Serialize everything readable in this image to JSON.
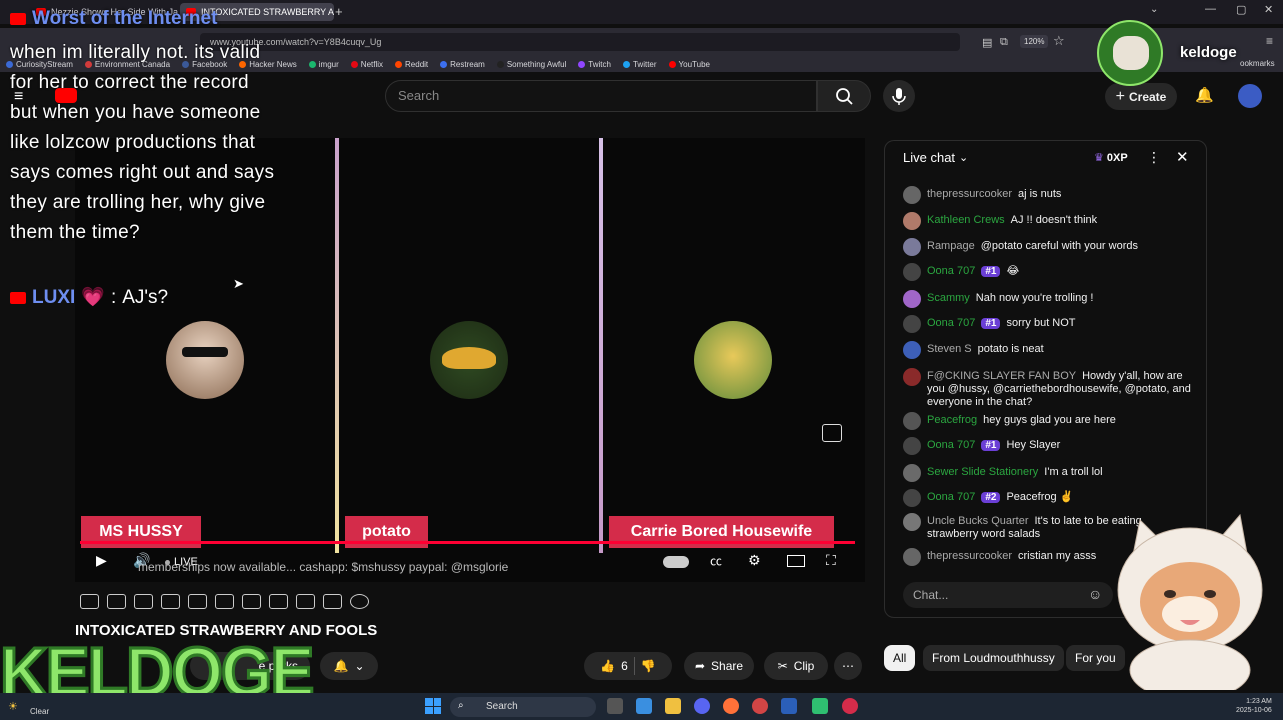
{
  "browser": {
    "tabs": [
      {
        "title": "Nezzie Shows Her Side With Ja"
      },
      {
        "title": "INTOXICATED STRAWBERRY AN"
      }
    ],
    "new_tab_icon": "plus-icon",
    "url": "www.youtube.com/watch?v=Y8B4cuqv_Ug",
    "zoom": "120%",
    "bookmarks": [
      {
        "label": "CuriosityStream",
        "color": "#3b6ad6"
      },
      {
        "label": "Environment Canada",
        "color": "#d13b3b"
      },
      {
        "label": "Facebook",
        "color": "#3b5998"
      },
      {
        "label": "Hacker News",
        "color": "#ff6600"
      },
      {
        "label": "imgur",
        "color": "#1bb76e"
      },
      {
        "label": "Netflix",
        "color": "#e50914"
      },
      {
        "label": "Reddit",
        "color": "#ff4500"
      },
      {
        "label": "Restream",
        "color": "#3c6ff0"
      },
      {
        "label": "Something Awful",
        "color": "#222222"
      },
      {
        "label": "Twitch",
        "color": "#9146ff"
      },
      {
        "label": "Twitter",
        "color": "#1da1f2"
      },
      {
        "label": "YouTube",
        "color": "#ff0000"
      }
    ],
    "bookmarks_more": "ookmarks"
  },
  "youtube": {
    "search_placeholder": "Search",
    "create_label": "Create",
    "video_title": "INTOXICATED STRAWBERRY AND FOOLS",
    "join_label": "e perks",
    "like_count": "6",
    "share_label": "Share",
    "clip_label": "Clip",
    "live_label": "LIVE",
    "ticker": "memberships now available... cashapp: $mshussy paypal: @msglorie",
    "participants": [
      {
        "name": "MS HUSSY",
        "avatar_color": "#c9a48a"
      },
      {
        "name": "potato",
        "avatar_color": "#6b8a3a"
      },
      {
        "name": "Carrie Bored Housewife",
        "avatar_color": "#9fb43a"
      }
    ],
    "chat": {
      "title": "Live chat",
      "xp": "0XP",
      "input_placeholder": "Chat...",
      "messages": [
        {
          "author": "thepressurcooker",
          "text": "aj is nuts",
          "color": "#aaaaaa",
          "badge": "",
          "avatar": "#666666"
        },
        {
          "author": "Kathleen Crews",
          "text": "AJ !! doesn't think",
          "color": "#2ba640",
          "badge": "",
          "avatar": "#b07a6a"
        },
        {
          "author": "Rampage",
          "text": "@potato careful with your words",
          "color": "#aaaaaa",
          "badge": "",
          "avatar": "#7a7a9a"
        },
        {
          "author": "Oona 707",
          "text": "😂",
          "color": "#2ba640",
          "badge": "#1",
          "avatar": "#444444"
        },
        {
          "author": "Scammy",
          "text": "Nah now you're trolling !",
          "color": "#2ba640",
          "badge": "",
          "avatar": "#a066c8"
        },
        {
          "author": "Oona 707",
          "text": "sorry but NOT",
          "color": "#2ba640",
          "badge": "#1",
          "avatar": "#444444"
        },
        {
          "author": "Steven S",
          "text": "potato is neat",
          "color": "#aaaaaa",
          "badge": "",
          "avatar": "#3d5fb8"
        },
        {
          "author": "F@CKING SLAYER FAN BOY",
          "text": "Howdy y'all, how are you @hussy, @carriethebordhousewife, @potato, and everyone in the chat?",
          "color": "#aaaaaa",
          "badge": "",
          "avatar": "#8a2a2a"
        },
        {
          "author": "Peacefrog",
          "text": "hey guys glad you are here",
          "color": "#2ba640",
          "badge": "",
          "avatar": "#555555"
        },
        {
          "author": "Oona 707",
          "text": "Hey Slayer",
          "color": "#2ba640",
          "badge": "#1",
          "avatar": "#444444"
        },
        {
          "author": "Sewer Slide Stationery",
          "text": "I'm a troll lol",
          "color": "#2ba640",
          "badge": "",
          "avatar": "#6a6a6a"
        },
        {
          "author": "Oona 707",
          "text": "Peacefrog ✌️",
          "color": "#2ba640",
          "badge": "#2",
          "avatar": "#444444"
        },
        {
          "author": "Uncle Bucks Quarter",
          "text": "It's to late to be eating strawberry word salads",
          "color": "#aaaaaa",
          "badge": "",
          "avatar": "#777777"
        },
        {
          "author": "thepressurcooker",
          "text": "cristian my asss",
          "color": "#aaaaaa",
          "badge": "",
          "avatar": "#666666"
        }
      ]
    },
    "chips": [
      "All",
      "From Loudmouthhussy",
      "For you"
    ]
  },
  "overlay": {
    "header": "Worst of the Internet",
    "text": "when im literally not. its valid for her to correct the record but when you have someone like lolzcow productions that says comes right out and says they are trolling her, why give them the time?",
    "luxi_name": "LUXI",
    "luxi_sep": ":",
    "luxi_text": "AJ's?",
    "streamer_name": "keldoge",
    "logo_text": "KELDOGE"
  },
  "taskbar": {
    "weather": "Clear",
    "search_label": "Search",
    "time": "1:23 AM",
    "date": "2025-10-06"
  }
}
